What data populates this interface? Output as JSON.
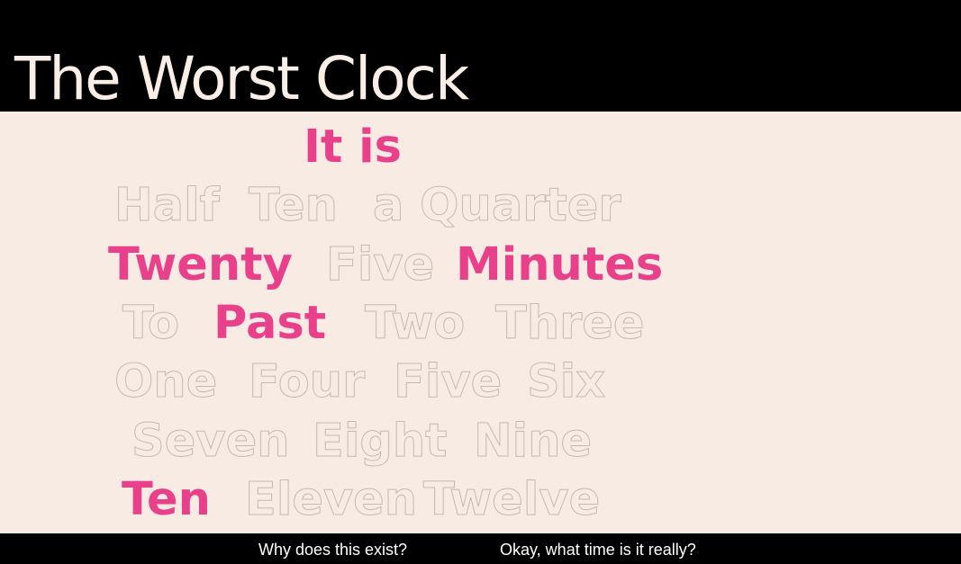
{
  "header": {
    "title": "The Worst Clock"
  },
  "clock": {
    "active_color": "#e8408a",
    "inactive_color": "#f7ebe4",
    "background_color": "#f7ebe4",
    "words": [
      {
        "text": "It is",
        "active": true
      },
      {
        "text": "Half",
        "active": false
      },
      {
        "text": "Ten",
        "active": false
      },
      {
        "text": "a Quarter",
        "active": false
      },
      {
        "text": "Twenty",
        "active": true
      },
      {
        "text": "Five",
        "active": false
      },
      {
        "text": "Minutes",
        "active": true
      },
      {
        "text": "To",
        "active": false
      },
      {
        "text": "Past",
        "active": true
      },
      {
        "text": "Two",
        "active": false
      },
      {
        "text": "Three",
        "active": false
      },
      {
        "text": "One",
        "active": false
      },
      {
        "text": "Four",
        "active": false
      },
      {
        "text": "Five",
        "active": false
      },
      {
        "text": "Six",
        "active": false
      },
      {
        "text": "Seven",
        "active": false
      },
      {
        "text": "Eight",
        "active": false
      },
      {
        "text": "Nine",
        "active": false
      },
      {
        "text": "Ten",
        "active": true
      },
      {
        "text": "Eleven",
        "active": false
      },
      {
        "text": "Twelve",
        "active": false
      }
    ]
  },
  "footer": {
    "why_link": "Why does this exist?",
    "time_link": "Okay, what time is it really?"
  }
}
